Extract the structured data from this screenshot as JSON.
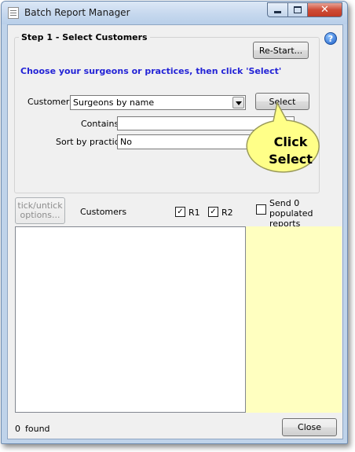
{
  "window": {
    "title": "Batch Report Manager",
    "close_glyph": "✕",
    "help_glyph": "?"
  },
  "step1": {
    "title": "Step 1 - Select Customers",
    "restart_label": "Re-Start...",
    "instruction": "Choose your surgeons or practices, then click 'Select'",
    "customers_label": "Customers",
    "customers_value": "Surgeons by name",
    "select_label": "Select",
    "contains_label": "Contains",
    "contains_value": "",
    "sort_label": "Sort by practice",
    "sort_value": "No"
  },
  "callout": {
    "text": "Click Select",
    "fill": "#ffff88",
    "stroke": "#9a9a5a"
  },
  "list_header": {
    "tick_label": "tick/untick options...",
    "customers_label": "Customers",
    "r1_label": "R1",
    "r1_checked": "✓",
    "r2_label": "R2",
    "r2_checked": "✓",
    "send0_label": "Send 0 populated reports",
    "send0_checked": ""
  },
  "footer": {
    "found_count": "0",
    "found_label": "found",
    "close_label": "Close"
  },
  "colors": {
    "instruction": "#2323d6",
    "yellow_panel": "#ffffc0",
    "title_close": "#c23a24"
  }
}
